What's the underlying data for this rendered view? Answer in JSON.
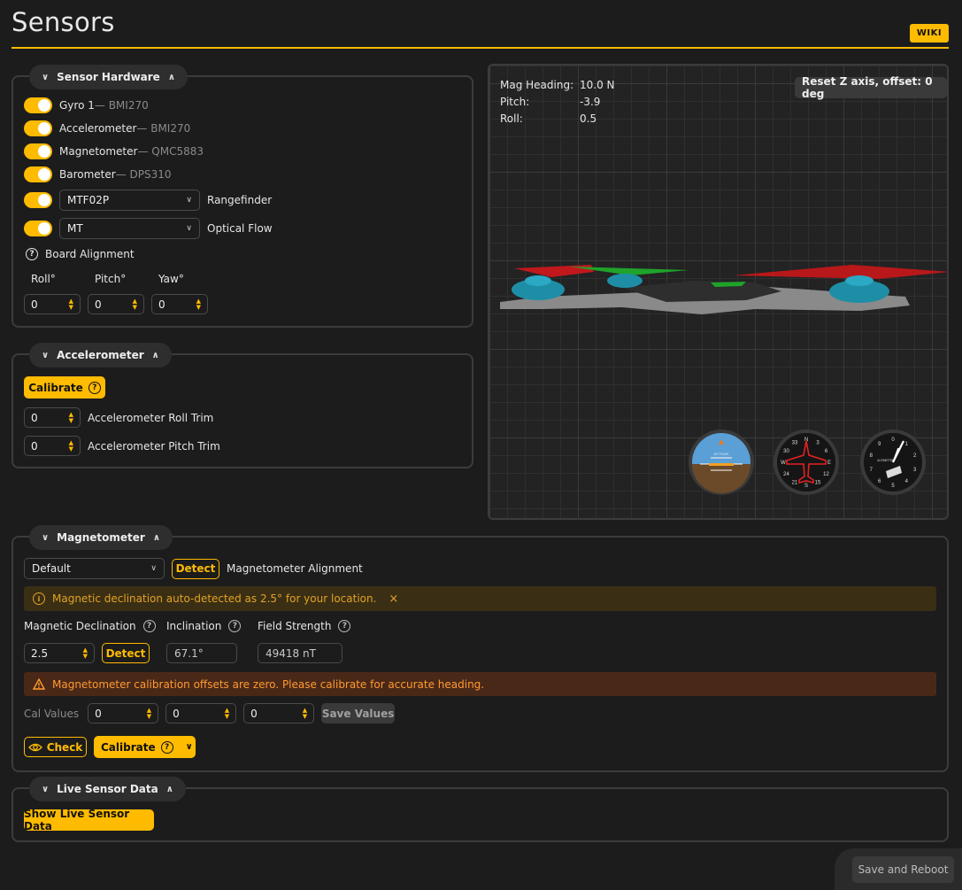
{
  "page": {
    "title": "Sensors",
    "wiki_label": "WIKI"
  },
  "hardware": {
    "tab_label": "Sensor Hardware",
    "sensors": [
      {
        "name": "Gyro 1",
        "chip": "— BMI270"
      },
      {
        "name": "Accelerometer",
        "chip": "— BMI270"
      },
      {
        "name": "Magnetometer",
        "chip": "— QMC5883"
      },
      {
        "name": "Barometer",
        "chip": "— DPS310"
      }
    ],
    "rangefinder": {
      "value": "MTF02P",
      "label": "Rangefinder"
    },
    "opticalflow": {
      "value": "MT",
      "label": "Optical Flow"
    },
    "board_alignment_label": "Board Alignment",
    "roll_label": "Roll°",
    "pitch_label": "Pitch°",
    "yaw_label": "Yaw°",
    "roll": "0",
    "pitch": "0",
    "yaw": "0"
  },
  "accel": {
    "tab_label": "Accelerometer",
    "calibrate_label": "Calibrate",
    "roll_trim": "0",
    "roll_trim_label": "Accelerometer Roll Trim",
    "pitch_trim": "0",
    "pitch_trim_label": "Accelerometer Pitch Trim"
  },
  "viewer": {
    "mag_heading_label": "Mag Heading:",
    "mag_heading": "10.0 N",
    "pitch_label": "Pitch:",
    "pitch": "-3.9",
    "roll_label": "Roll:",
    "roll": "0.5",
    "reset_label": "Reset Z axis, offset: 0 deg",
    "attitude_text": "ATTITUDE",
    "altimeter_text": "ALTIMETER",
    "compass_labels": [
      "N",
      "3",
      "6",
      "E",
      "12",
      "15",
      "S",
      "21",
      "24",
      "W",
      "30",
      "33"
    ],
    "altimeter_digits": [
      "0",
      "1",
      "2",
      "3",
      "4",
      "5",
      "6",
      "7",
      "8",
      "9"
    ]
  },
  "mag": {
    "tab_label": "Magnetometer",
    "alignment_value": "Default",
    "detect_label": "Detect",
    "alignment_label": "Magnetometer Alignment",
    "info_text": "Magnetic declination auto-detected as 2.5° for your location.",
    "info_close": "×",
    "declination_label": "Magnetic Declination",
    "inclination_label": "Inclination",
    "field_label": "Field Strength",
    "declination": "2.5",
    "detect2_label": "Detect",
    "inclination": "67.1°",
    "field": "49418 nT",
    "warn_text": "Magnetometer calibration offsets are zero. Please calibrate for accurate heading.",
    "cal_label": "Cal Values",
    "cal": [
      "0",
      "0",
      "0"
    ],
    "save_values_label": "Save Values",
    "check_label": "Check",
    "calibrate_label": "Calibrate"
  },
  "live": {
    "tab_label": "Live Sensor Data",
    "show_label": "Show Live Sensor Data"
  },
  "footer": {
    "save_reboot_label": "Save and Reboot"
  },
  "colors": {
    "accent": "#ffbb00",
    "panel_border": "#3c3c3c",
    "warn": "#ff9a2f"
  }
}
